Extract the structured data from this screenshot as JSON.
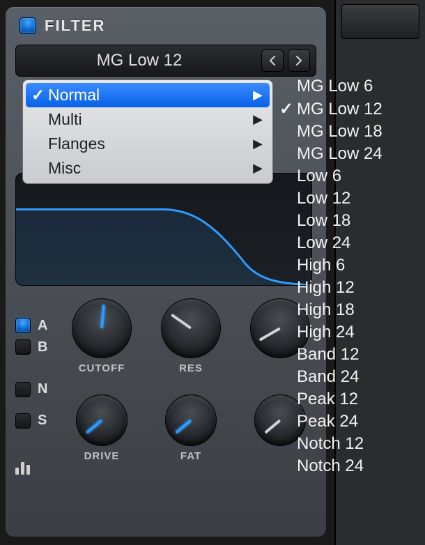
{
  "header": {
    "title": "FILTER"
  },
  "preset": {
    "current": "MG Low 12"
  },
  "dropdown": {
    "items": [
      {
        "label": "Normal",
        "checked": true,
        "selected": true
      },
      {
        "label": "Multi",
        "checked": false,
        "selected": false
      },
      {
        "label": "Flanges",
        "checked": false,
        "selected": false
      },
      {
        "label": "Misc",
        "checked": false,
        "selected": false
      }
    ]
  },
  "submenu": {
    "items": [
      {
        "label": "MG Low 6",
        "checked": false
      },
      {
        "label": "MG Low 12",
        "checked": true
      },
      {
        "label": "MG Low 18",
        "checked": false
      },
      {
        "label": "MG Low 24",
        "checked": false
      },
      {
        "label": "Low 6",
        "checked": false
      },
      {
        "label": "Low 12",
        "checked": false
      },
      {
        "label": "Low 18",
        "checked": false
      },
      {
        "label": "Low 24",
        "checked": false
      },
      {
        "label": "High 6",
        "checked": false
      },
      {
        "label": "High 12",
        "checked": false
      },
      {
        "label": "High 18",
        "checked": false
      },
      {
        "label": "High 24",
        "checked": false
      },
      {
        "label": "Band 12",
        "checked": false
      },
      {
        "label": "Band 24",
        "checked": false
      },
      {
        "label": "Peak 12",
        "checked": false
      },
      {
        "label": "Peak 24",
        "checked": false
      },
      {
        "label": "Notch 12",
        "checked": false
      },
      {
        "label": "Notch 24",
        "checked": false
      }
    ]
  },
  "toggles": {
    "a": "A",
    "b": "B",
    "n": "N",
    "s": "S"
  },
  "knobs": {
    "cutoff": "CUTOFF",
    "res": "RES",
    "drive": "DRIVE",
    "fat": "FAT"
  }
}
